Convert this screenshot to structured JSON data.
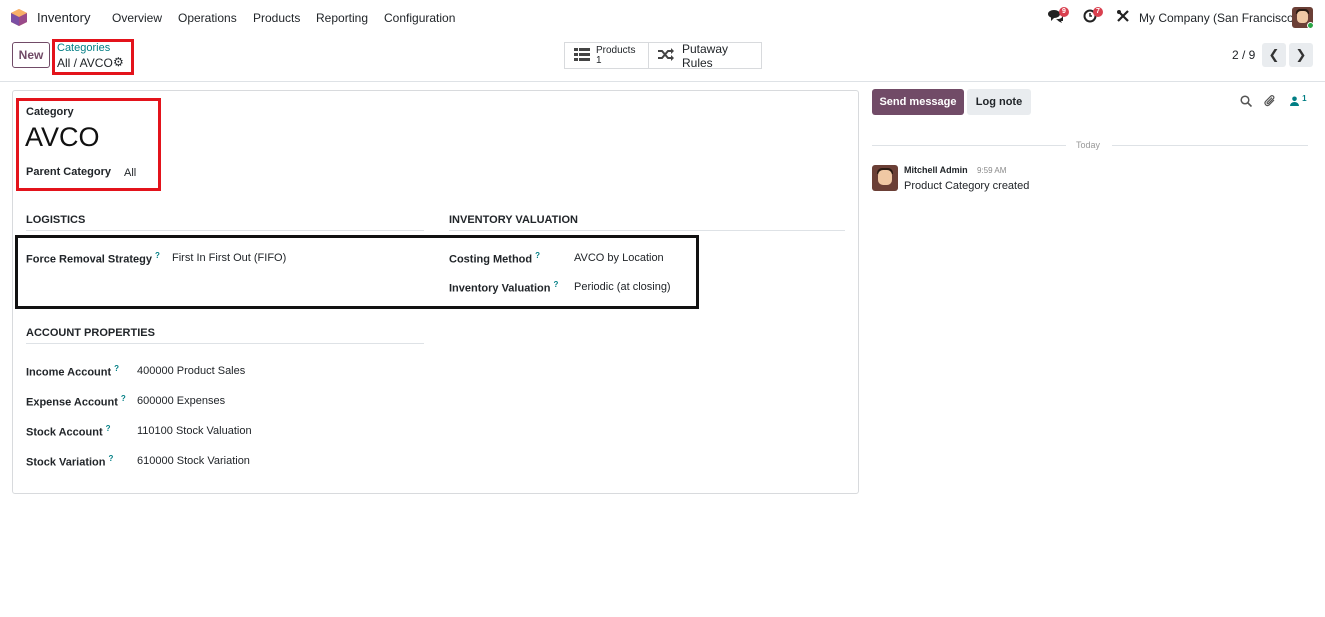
{
  "nav": {
    "app_name": "Inventory",
    "items": [
      "Overview",
      "Operations",
      "Products",
      "Reporting",
      "Configuration"
    ],
    "messages_count": "9",
    "activities_count": "7",
    "company": "My Company (San Francisco)"
  },
  "control": {
    "new_label": "New",
    "breadcrumb_parent": "Categories",
    "breadcrumb_current": "All / AVCO",
    "smart_products_label": "Products",
    "smart_products_count": "1",
    "smart_putaway_label": "Putaway Rules",
    "pager": "2 / 9"
  },
  "form": {
    "category_label": "Category",
    "name": "AVCO",
    "parent_label": "Parent Category",
    "parent_value": "All",
    "logistics": {
      "title": "LOGISTICS",
      "removal_label": "Force Removal Strategy",
      "removal_value": "First In First Out (FIFO)"
    },
    "valuation": {
      "title": "INVENTORY VALUATION",
      "costing_label": "Costing Method",
      "costing_value": "AVCO by Location",
      "valuation_label": "Inventory Valuation",
      "valuation_value": "Periodic (at closing)"
    },
    "accounts": {
      "title": "ACCOUNT PROPERTIES",
      "rows": [
        {
          "label": "Income Account",
          "value": "400000 Product Sales"
        },
        {
          "label": "Expense Account",
          "value": "600000 Expenses"
        },
        {
          "label": "Stock Account",
          "value": "110100 Stock Valuation"
        },
        {
          "label": "Stock Variation",
          "value": "610000 Stock Variation"
        }
      ]
    },
    "help_mark": "?"
  },
  "chatter": {
    "send_label": "Send message",
    "log_label": "Log note",
    "followers_count": "1",
    "date_separator": "Today",
    "message": {
      "author": "Mitchell Admin",
      "time": "9:59 AM",
      "body": "Product Category created"
    }
  },
  "colors": {
    "brand": "#714b67",
    "link": "#017e84",
    "highlight_red": "#e3131b"
  }
}
